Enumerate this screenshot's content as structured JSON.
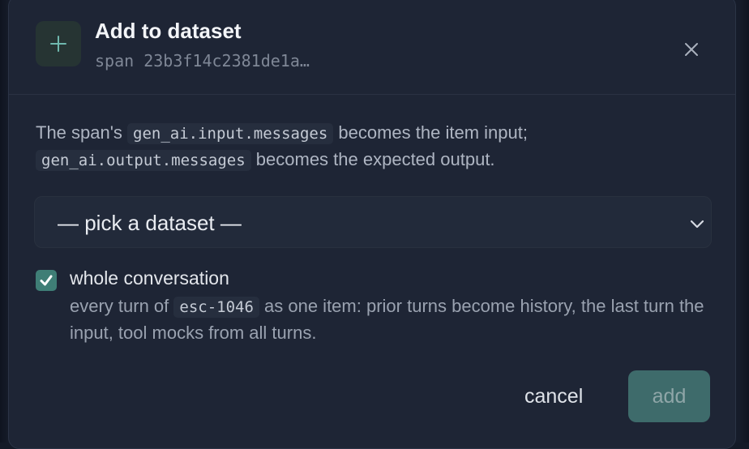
{
  "header": {
    "title": "Add to dataset",
    "subtitle": "span 23b3f14c2381de1a…",
    "icon": "plus-icon",
    "close_icon": "close-icon"
  },
  "description": {
    "part1": "The span's ",
    "code1": "gen_ai.input.messages",
    "part2": " becomes the item input;",
    "code2": "gen_ai.output.messages",
    "part3": " becomes the expected output."
  },
  "dataset_select": {
    "value": "— pick a dataset —",
    "icon": "chevron-down-icon"
  },
  "whole_conversation": {
    "checked": true,
    "label": "whole conversation",
    "desc_part1": "every turn of ",
    "desc_code": "esc-1046",
    "desc_part2": " as one item: prior turns become history, the last turn the input, tool mocks from all turns."
  },
  "actions": {
    "cancel_label": "cancel",
    "add_label": "add"
  },
  "colors": {
    "accent": "#3f7e76",
    "dialog_bg": "#1e2535",
    "add_button_bg": "#3e6b6b"
  }
}
